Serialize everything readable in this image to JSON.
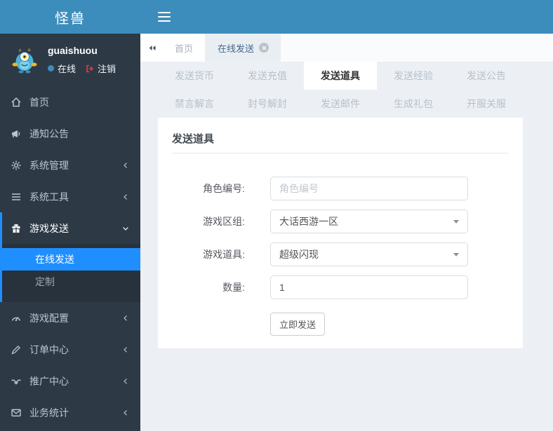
{
  "app": {
    "logo_title": "怪兽"
  },
  "user": {
    "name": "guaishuou",
    "status_label": "在线",
    "logout_label": "注销"
  },
  "sidebar": {
    "items": [
      {
        "label": "首页",
        "icon": "home-icon"
      },
      {
        "label": "通知公告",
        "icon": "bullhorn-icon"
      },
      {
        "label": "系统管理",
        "icon": "gear-icon",
        "arrow": "left"
      },
      {
        "label": "系统工具",
        "icon": "bars-icon",
        "arrow": "left"
      },
      {
        "label": "游戏发送",
        "icon": "gift-icon",
        "arrow": "down",
        "expanded": true,
        "children": [
          {
            "label": "在线发送",
            "active": true
          },
          {
            "label": "定制"
          }
        ]
      },
      {
        "label": "游戏配置",
        "icon": "gauge-icon",
        "arrow": "left"
      },
      {
        "label": "订单中心",
        "icon": "pencil-icon",
        "arrow": "left"
      },
      {
        "label": "推广中心",
        "icon": "handshake-icon",
        "arrow": "left"
      },
      {
        "label": "业务统计",
        "icon": "envelope-icon",
        "arrow": "left"
      }
    ]
  },
  "tabbar": {
    "tabs": [
      {
        "label": "首页"
      },
      {
        "label": "在线发送",
        "active": true,
        "closable": true
      }
    ]
  },
  "func_tabs": {
    "active": "发送道具",
    "items": [
      "发送货币",
      "发送充值",
      "发送道具",
      "发送经验",
      "发送公告",
      "禁言解言",
      "封号解封",
      "发送邮件",
      "生成礼包",
      "开服关服"
    ]
  },
  "form": {
    "title": "发送道具",
    "fields": {
      "role_id": {
        "label": "角色编号:",
        "placeholder": "角色编号",
        "value": ""
      },
      "zone": {
        "label": "游戏区组:",
        "value": "大话西游一区"
      },
      "item": {
        "label": "游戏道具:",
        "value": "超级闪现"
      },
      "qty": {
        "label": "数量:",
        "value": "1"
      }
    },
    "submit_label": "立即发送"
  },
  "colors": {
    "header_blue": "#3c8dbc",
    "sidebar_bg": "#2d3a46",
    "submenu_bg": "#27323d",
    "active_item_blue": "#1f8fff",
    "content_bg": "#ecf0f5",
    "active_tab_text": "#44688f",
    "logout_red": "#e8384f",
    "online_dot": "#3c8dbc"
  }
}
